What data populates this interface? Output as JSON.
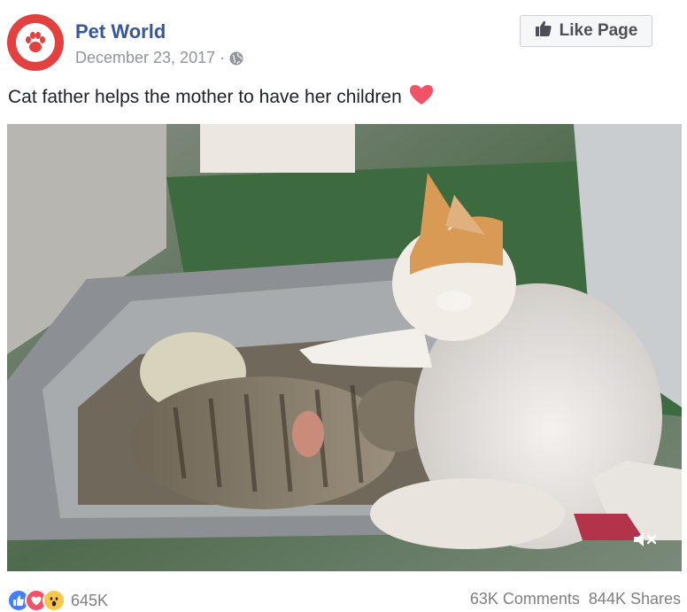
{
  "header": {
    "page_name": "Pet World",
    "date": "December 23, 2017",
    "separator": "·",
    "like_button_label": "Like Page"
  },
  "post": {
    "caption": "Cat father helps the mother to have her children"
  },
  "video": {
    "muted": true
  },
  "footer": {
    "reaction_count": "645K",
    "comments": "63K Comments",
    "shares": "844K Shares",
    "reaction_icons": [
      "like-icon",
      "love-icon",
      "wow-icon"
    ]
  },
  "colors": {
    "brand_red": "#e2413f",
    "link_blue": "#365899",
    "heart": "#f25268",
    "like_blue": "#4080ff"
  }
}
